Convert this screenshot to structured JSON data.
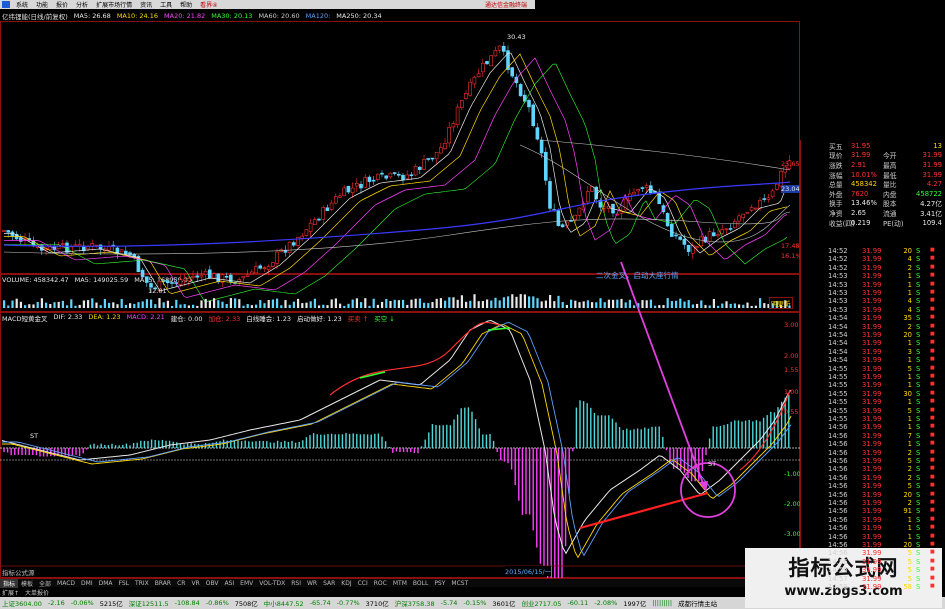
{
  "menubar": {
    "items": [
      "系统",
      "功能",
      "报价",
      "分析",
      "扩展市场行情",
      "资讯",
      "工具",
      "帮助"
    ],
    "highlight": "看界④",
    "brand": "通达信金融终端"
  },
  "price_header": {
    "title": "亿纬锂能(日线/前复权)",
    "ma": [
      {
        "label": "MA5: 26.68",
        "color": "#e8e8e8"
      },
      {
        "label": "MA10: 24.16",
        "color": "#ffd800"
      },
      {
        "label": "MA20: 21.82",
        "color": "#ff40ff"
      },
      {
        "label": "MA30: 20.13",
        "color": "#30ff30"
      },
      {
        "label": "MA60: 20.60",
        "color": "#c8c8c8"
      },
      {
        "label": "MA120: ",
        "color": "#5f9fff"
      },
      {
        "label": "MA250: 20.34",
        "color": "#e8e8e8"
      }
    ]
  },
  "volume_header": {
    "items": [
      {
        "label": "VOLUME: 458342.47",
        "color": "#e8e8e8"
      },
      {
        "label": "MA5: 149025.59",
        "color": "#e8e8e8"
      },
      {
        "label": "MA55: 168959.06",
        "color": "#e8e8e8"
      }
    ]
  },
  "macd_header": {
    "items": [
      {
        "label": "MACD短黄金叉",
        "color": "#e8e8e8"
      },
      {
        "label": "DIF: 2.33",
        "color": "#e8e8e8"
      },
      {
        "label": "DEA: 1.23",
        "color": "#ffd800"
      },
      {
        "label": "MACD: 2.21",
        "color": "#ff40ff"
      },
      {
        "label": "建仓: 0.00",
        "color": "#e8e8e8"
      },
      {
        "label": "加仓: 2.33",
        "color": "#ff3030"
      },
      {
        "label": "白线睡会: 1.23",
        "color": "#e8e8e8"
      },
      {
        "label": "启动做好: 1.23",
        "color": "#e8e8e8"
      },
      {
        "label": "买卖 ↑",
        "color": "#ff3030"
      },
      {
        "label": "买空 ↓",
        "color": "#30ff30"
      }
    ]
  },
  "annotations": {
    "high_label": "30.43",
    "low_label": "12.01",
    "arrow_text": "二次金叉，启动大座行情",
    "macd_low_label": "-2.01",
    "date_label": "2015/06/15/一",
    "formula_label": "指标公式源",
    "gold_label": "ST",
    "gold_label2": "ST",
    "vol_btn": "明更新"
  },
  "price_axis": [
    "25.65",
    "23.04",
    "17.48",
    "16.1%"
  ],
  "macd_axis": [
    "3.00",
    "2.00",
    "1.55",
    "1.00",
    "0.55",
    "-1.00",
    "-2.00",
    "-3.00"
  ],
  "quote": {
    "rows": [
      {
        "l": "买五",
        "v": "31.95",
        "c1": "red",
        "l2": "",
        "v2": "13",
        "c2": "yel"
      },
      {
        "l": "现价",
        "v": "31.99",
        "c1": "red",
        "l2": "今开",
        "v2": "31.99",
        "c2": "red"
      },
      {
        "l": "涨跌",
        "v": "2.91",
        "c1": "red",
        "l2": "最高",
        "v2": "31.99",
        "c2": "red"
      },
      {
        "l": "涨幅",
        "v": "10.01%",
        "c1": "red",
        "l2": "最低",
        "v2": "31.99",
        "c2": "red"
      },
      {
        "l": "总量",
        "v": "458342",
        "c1": "yel",
        "l2": "量比",
        "v2": "4.27",
        "c2": "red"
      },
      {
        "l": "外盘",
        "v": "7620",
        "c1": "red",
        "l2": "内盘",
        "v2": "458722",
        "c2": "grn"
      },
      {
        "l": "换手",
        "v": "13.46%",
        "c1": "wht",
        "l2": "股本",
        "v2": "4.27亿",
        "c2": "wht"
      },
      {
        "l": "净资",
        "v": "2.65",
        "c1": "wht",
        "l2": "流通",
        "v2": "3.41亿",
        "c2": "wht"
      },
      {
        "l": "收益(四)",
        "v": "0.219",
        "c1": "wht",
        "l2": "PE(动)",
        "v2": "109.4",
        "c2": "wht"
      }
    ],
    "ticks": [
      {
        "t": "14:52",
        "p": "31.99",
        "v": "20",
        "bs": "S"
      },
      {
        "t": "14:52",
        "p": "31.99",
        "v": "4",
        "bs": "S"
      },
      {
        "t": "14:52",
        "p": "31.99",
        "v": "2",
        "bs": "S"
      },
      {
        "t": "14:53",
        "p": "31.99",
        "v": "1",
        "bs": "S"
      },
      {
        "t": "14:53",
        "p": "31.99",
        "v": "1",
        "bs": "S"
      },
      {
        "t": "14:53",
        "p": "31.99",
        "v": "1",
        "bs": "S"
      },
      {
        "t": "14:53",
        "p": "31.99",
        "v": "4",
        "bs": "S"
      },
      {
        "t": "14:53",
        "p": "31.99",
        "v": "4",
        "bs": "S"
      },
      {
        "t": "14:54",
        "p": "31.99",
        "v": "35",
        "bs": "S"
      },
      {
        "t": "14:54",
        "p": "31.99",
        "v": "2",
        "bs": "S"
      },
      {
        "t": "14:54",
        "p": "31.99",
        "v": "20",
        "bs": "S"
      },
      {
        "t": "14:54",
        "p": "31.99",
        "v": "1",
        "bs": "S"
      },
      {
        "t": "14:54",
        "p": "31.99",
        "v": "3",
        "bs": "S"
      },
      {
        "t": "14:54",
        "p": "31.99",
        "v": "1",
        "bs": "S"
      },
      {
        "t": "14:55",
        "p": "31.99",
        "v": "5",
        "bs": "S"
      },
      {
        "t": "14:55",
        "p": "31.99",
        "v": "1",
        "bs": "S"
      },
      {
        "t": "14:55",
        "p": "31.99",
        "v": "1",
        "bs": "S"
      },
      {
        "t": "14:55",
        "p": "31.99",
        "v": "30",
        "bs": "S"
      },
      {
        "t": "14:55",
        "p": "31.99",
        "v": "1",
        "bs": "S"
      },
      {
        "t": "14:55",
        "p": "31.99",
        "v": "5",
        "bs": "S"
      },
      {
        "t": "14:55",
        "p": "31.99",
        "v": "1",
        "bs": "S"
      },
      {
        "t": "14:56",
        "p": "31.99",
        "v": "1",
        "bs": "S"
      },
      {
        "t": "14:56",
        "p": "31.99",
        "v": "7",
        "bs": "S"
      },
      {
        "t": "14:56",
        "p": "31.99",
        "v": "1",
        "bs": "S"
      },
      {
        "t": "14:56",
        "p": "31.99",
        "v": "2",
        "bs": "S"
      },
      {
        "t": "14:56",
        "p": "31.99",
        "v": "5",
        "bs": "S"
      },
      {
        "t": "14:56",
        "p": "31.99",
        "v": "2",
        "bs": "S"
      },
      {
        "t": "14:56",
        "p": "31.99",
        "v": "2",
        "bs": "S"
      },
      {
        "t": "14:56",
        "p": "31.99",
        "v": "5",
        "bs": "S"
      },
      {
        "t": "14:56",
        "p": "31.99",
        "v": "20",
        "bs": "S"
      },
      {
        "t": "14:56",
        "p": "31.99",
        "v": "2",
        "bs": "S"
      },
      {
        "t": "14:56",
        "p": "31.99",
        "v": "91",
        "bs": "S"
      },
      {
        "t": "14:56",
        "p": "31.99",
        "v": "1",
        "bs": "S"
      },
      {
        "t": "14:56",
        "p": "31.99",
        "v": "1",
        "bs": "S"
      },
      {
        "t": "14:56",
        "p": "31.99",
        "v": "1",
        "bs": "S"
      },
      {
        "t": "14:56",
        "p": "31.99",
        "v": "20",
        "bs": "S"
      },
      {
        "t": "14:56",
        "p": "31.99",
        "v": "5",
        "bs": "S"
      },
      {
        "t": "14:56",
        "p": "31.99",
        "v": "5",
        "bs": "S"
      },
      {
        "t": "14:56",
        "p": "31.99",
        "v": "5",
        "bs": "S"
      },
      {
        "t": "14:57",
        "p": "31.99",
        "v": "5",
        "bs": "S"
      },
      {
        "t": "14:59",
        "p": "31.99",
        "v": "58",
        "bs": "S"
      }
    ]
  },
  "tabbar": {
    "items": [
      "指标",
      "模板",
      "全部",
      "MACD",
      "DMI",
      "DMA",
      "FSL",
      "TRIX",
      "BRAR",
      "CR",
      "VR",
      "OBV",
      "ASI",
      "EMV",
      "VOL-TDX",
      "RSI",
      "WR",
      "SAR",
      "KDJ",
      "CCI",
      "ROC",
      "MTM",
      "BOLL",
      "PSY",
      "MCST"
    ],
    "active_index": 0
  },
  "hint_bar": {
    "items": [
      "扩展↑",
      "大单报价"
    ]
  },
  "statusbar": {
    "items": [
      {
        "text": "上证3604.00",
        "cls": "dn"
      },
      {
        "text": "-2.16",
        "cls": "dn"
      },
      {
        "text": "-0.06%",
        "cls": "dn"
      },
      {
        "text": "5215亿",
        "cls": ""
      },
      {
        "text": "深证12511.5",
        "cls": "dn"
      },
      {
        "text": "-108.84",
        "cls": "dn"
      },
      {
        "text": "-0.86%",
        "cls": "dn"
      },
      {
        "text": "7508亿",
        "cls": ""
      },
      {
        "text": "中小8447.52",
        "cls": "dn"
      },
      {
        "text": "-65.74",
        "cls": "dn"
      },
      {
        "text": "-0.77%",
        "cls": "dn"
      },
      {
        "text": "3710亿",
        "cls": ""
      },
      {
        "text": "沪深3758.38",
        "cls": "dn"
      },
      {
        "text": "-5.74",
        "cls": "dn"
      },
      {
        "text": "-0.15%",
        "cls": "dn"
      },
      {
        "text": "3601亿",
        "cls": ""
      },
      {
        "text": "创业2717.05",
        "cls": "dn"
      },
      {
        "text": "-60.11",
        "cls": "dn"
      },
      {
        "text": "-2.08%",
        "cls": "dn"
      },
      {
        "text": "1997亿",
        "cls": ""
      },
      {
        "text": "|||||||||",
        "cls": "dn"
      },
      {
        "text": "成都行情主站",
        "cls": ""
      }
    ]
  },
  "watermark": {
    "line1": "指标公式网",
    "line2": "www.zbgs3.com"
  },
  "colors": {
    "up": "#ff3030",
    "down": "#30ff30",
    "border": "#8a1010",
    "magenta": "#ff40ff",
    "yellow": "#ffd800",
    "blue": "#3a3aff"
  }
}
